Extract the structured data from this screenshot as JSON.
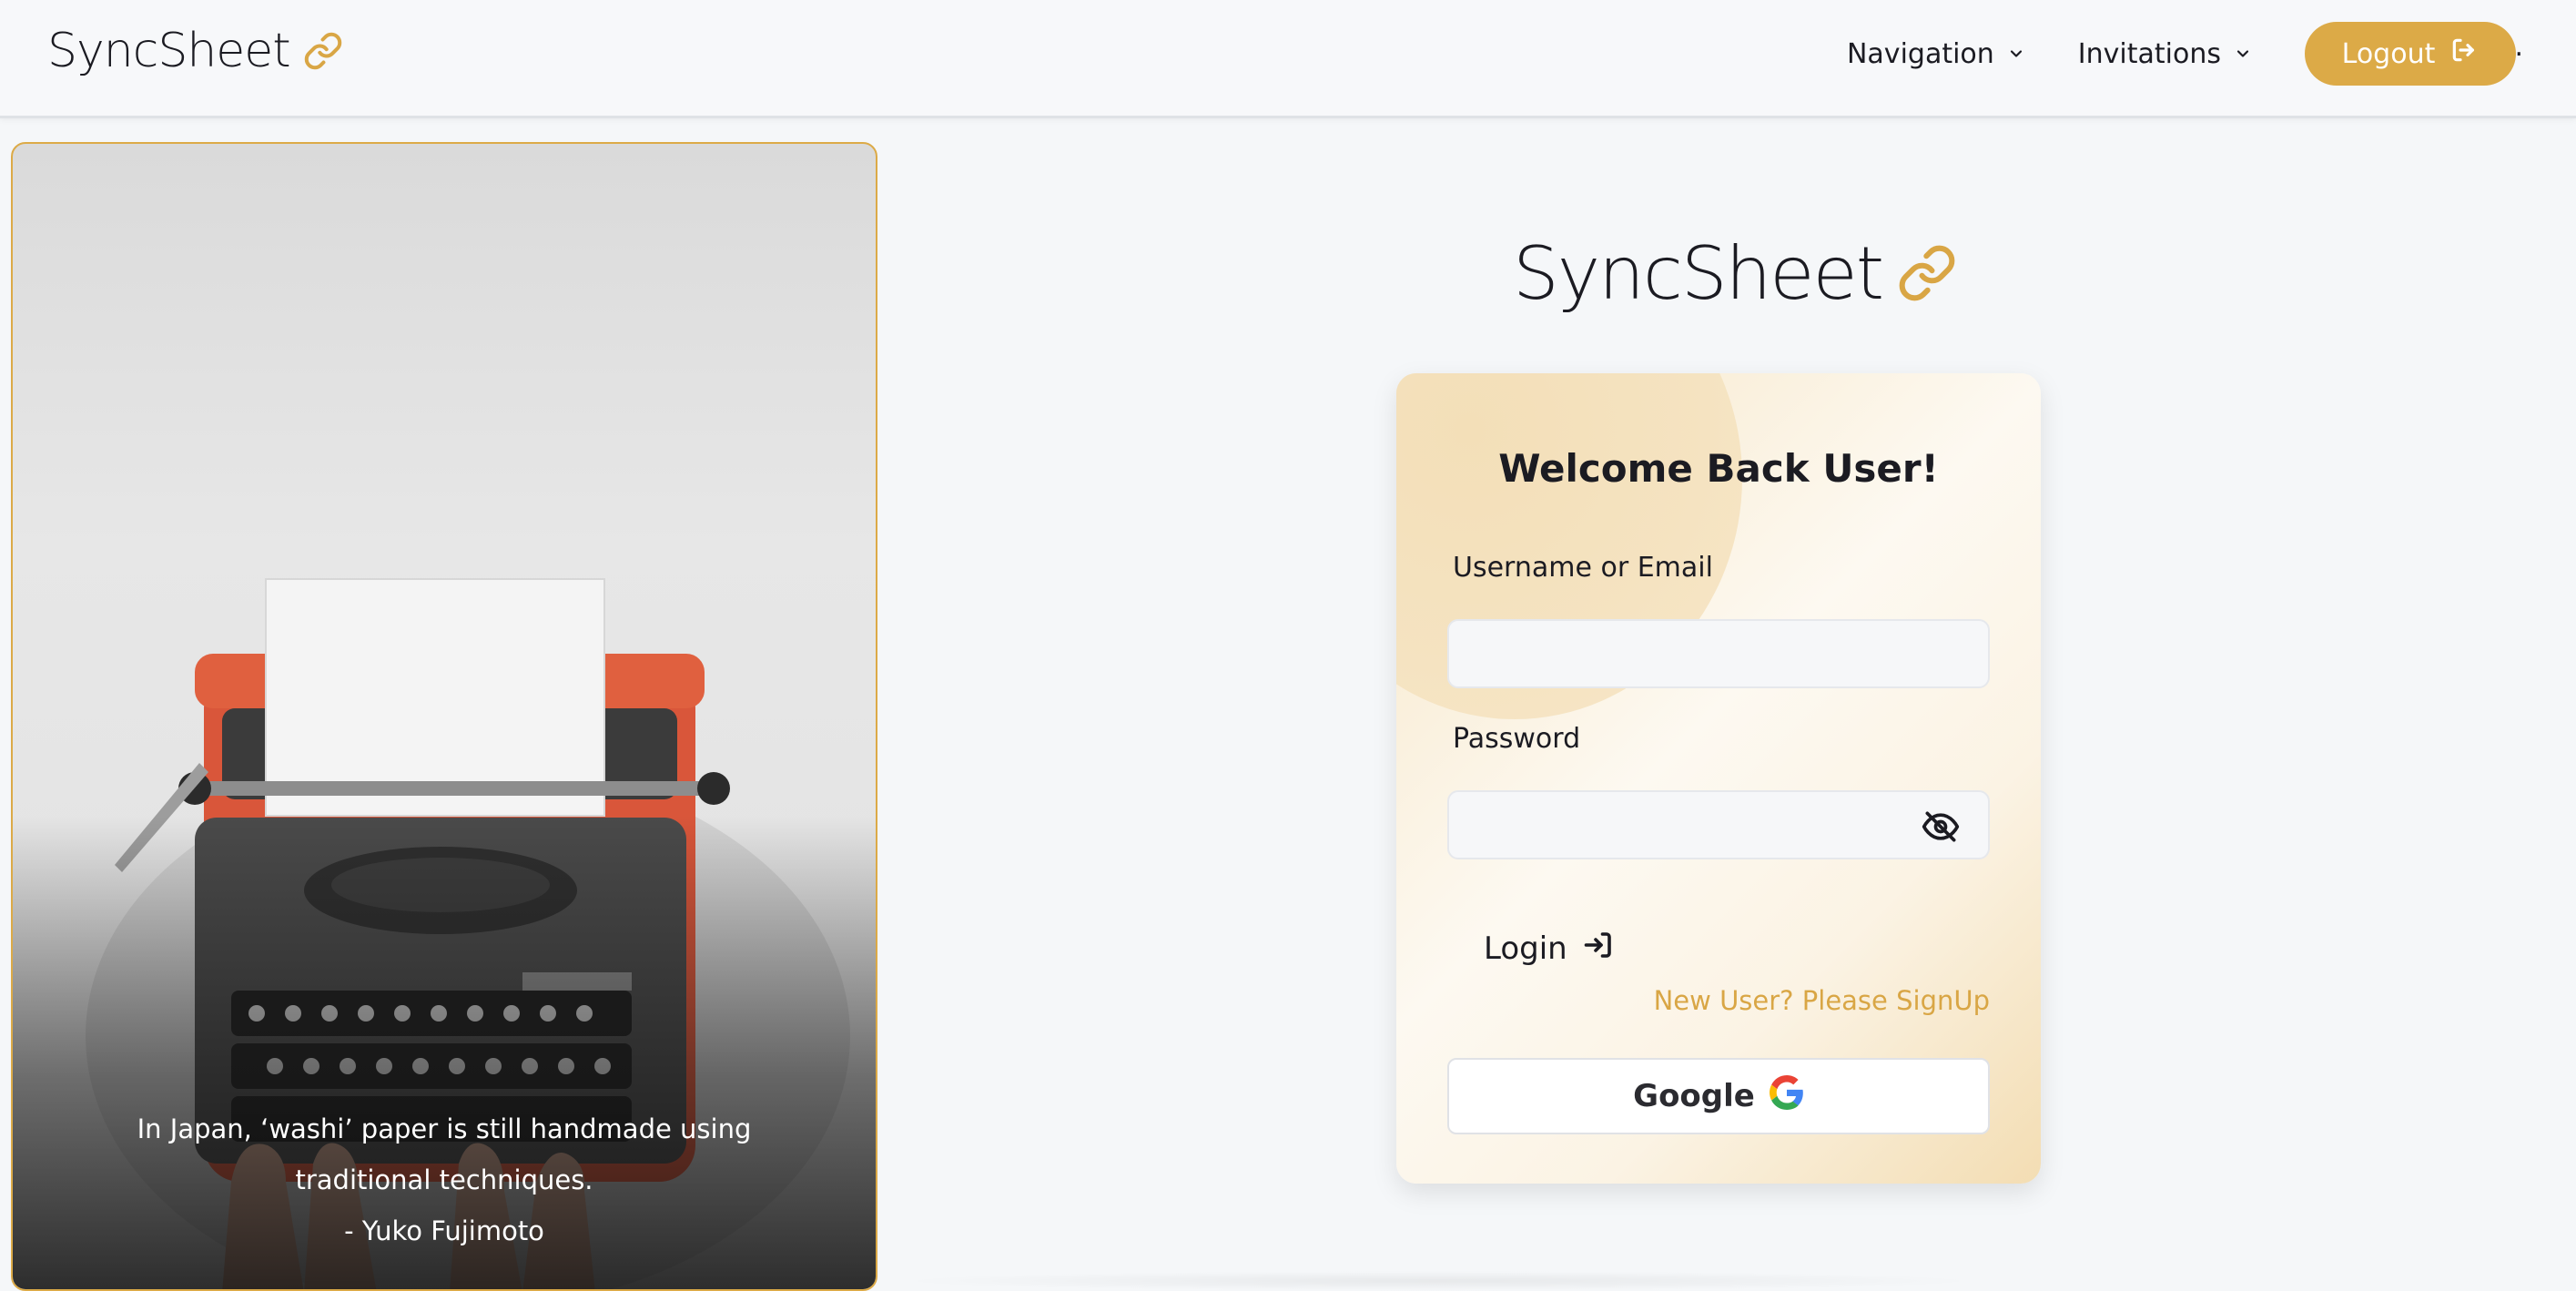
{
  "navbar": {
    "brand": "SyncSheet",
    "brand_icon": "link-icon",
    "menu": [
      {
        "label": "Navigation",
        "icon": "chevron-down-icon"
      },
      {
        "label": "Invitations",
        "icon": "chevron-down-icon"
      }
    ],
    "logout_label": "Logout",
    "trailing_dot": "."
  },
  "photo": {
    "quote_line": "In Japan, ‘washi’ paper is still handmade using traditional techniques.",
    "author": "- Yuko Fujimoto"
  },
  "login": {
    "brand": "SyncSheet",
    "title": "Welcome Back User!",
    "username_label": "Username or Email",
    "username_value": "",
    "password_label": "Password",
    "password_value": "",
    "login_label": "Login",
    "signup_link": "New User? Please SignUp",
    "google_label": "Google"
  },
  "colors": {
    "accent": "#dcaa47",
    "text": "#1b1b22",
    "background": "#f5f7f9"
  }
}
